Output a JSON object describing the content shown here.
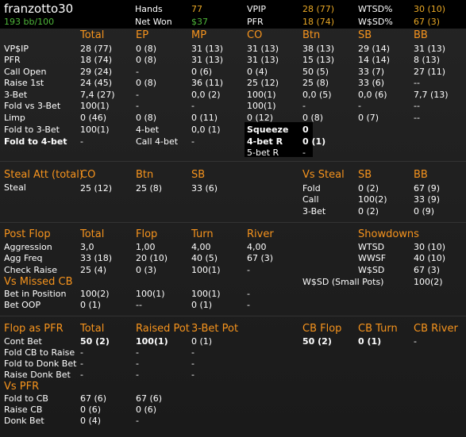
{
  "player": {
    "name": "franzotto30",
    "winrate": "193 bb/100"
  },
  "summary": {
    "hands_label": "Hands",
    "hands_value": "77",
    "netwon_label": "Net Won",
    "netwon_value": "$37",
    "vpip_label": "VPIP",
    "vpip_value": "28 (77)",
    "pfr_label": "PFR",
    "pfr_value": "18 (74)",
    "wtsd_label": "WTSD%",
    "wtsd_value": "30 (10)",
    "wsd_label": "W$SD%",
    "wsd_value": "67 (3)"
  },
  "preflop": {
    "headers": [
      "Total",
      "EP",
      "MP",
      "CO",
      "Btn",
      "SB",
      "BB"
    ],
    "rows": [
      {
        "label": "VP$IP",
        "cells": [
          "28 (77)",
          "0 (8)",
          "31 (13)",
          "31 (13)",
          "38 (13)",
          "29 (14)",
          "31 (13)"
        ]
      },
      {
        "label": "PFR",
        "cells": [
          "18 (74)",
          "0 (8)",
          "31 (13)",
          "31 (13)",
          "15 (13)",
          "14 (14)",
          "8 (13)"
        ]
      },
      {
        "label": "Call Open",
        "cells": [
          "29 (24)",
          "-",
          "0 (6)",
          "0 (4)",
          "50 (5)",
          "33 (7)",
          "27 (11)"
        ]
      },
      {
        "label": "Raise 1st",
        "cells": [
          "24 (45)",
          "0 (8)",
          "36 (11)",
          "25 (12)",
          "25 (8)",
          "33 (6)",
          "--"
        ]
      },
      {
        "label": "3-Bet",
        "cells": [
          "7,4 (27)",
          "-",
          "0,0 (2)",
          "100(1)",
          "0,0 (5)",
          "0,0 (6)",
          "7,7 (13)"
        ]
      },
      {
        "label": "Fold vs 3-Bet",
        "cells": [
          "100(1)",
          "-",
          "-",
          "100(1)",
          "-",
          "-",
          "--"
        ]
      },
      {
        "label": "Limp",
        "cells": [
          "0 (46)",
          "0 (8)",
          "0 (11)",
          "0 (12)",
          "0 (8)",
          "0 (7)",
          "--"
        ]
      }
    ],
    "fold_to_3bet_label": "Fold to 3-Bet",
    "fold_to_3bet_value": "100(1)",
    "fourbet_label": "4-bet",
    "fourbet_value": "0,0 (1)",
    "squeeze_label": "Squeeze",
    "squeeze_value": "0",
    "fold_to_4bet_label": "Fold to 4-bet",
    "fold_to_4bet_value": "-",
    "call_4bet_label": "Call 4-bet",
    "call_4bet_value": "-",
    "fourbet_r_label": "4-bet R",
    "fourbet_r_value": "0 (1)",
    "fivebet_r_label": "5-bet R",
    "fivebet_r_value": "-"
  },
  "steal": {
    "title": "Steal Att (total)",
    "headers": [
      "CO",
      "Btn",
      "SB"
    ],
    "row_label": "Steal",
    "cells": [
      "25 (12)",
      "25 (8)",
      "33 (6)"
    ]
  },
  "vs_steal": {
    "title": "Vs Steal",
    "headers": [
      "SB",
      "BB"
    ],
    "rows": [
      {
        "label": "Fold",
        "cells": [
          "0 (2)",
          "67 (9)"
        ]
      },
      {
        "label": "Call",
        "cells": [
          "100(2)",
          "33 (9)"
        ]
      },
      {
        "label": "3-Bet",
        "cells": [
          "0 (2)",
          "0 (9)"
        ]
      }
    ]
  },
  "postflop": {
    "title": "Post Flop",
    "headers": [
      "Total",
      "Flop",
      "Turn",
      "River"
    ],
    "rows": [
      {
        "label": "Aggression",
        "cells": [
          "3,0",
          "1,00",
          "4,00",
          "4,00"
        ]
      },
      {
        "label": "Agg Freq",
        "cells": [
          "33 (18)",
          "20 (10)",
          "40 (5)",
          "67 (3)"
        ]
      },
      {
        "label": "Check Raise",
        "cells": [
          "25 (4)",
          "0 (3)",
          "100(1)",
          "-"
        ]
      }
    ]
  },
  "showdowns": {
    "title": "Showdowns",
    "rows": [
      {
        "label": "WTSD",
        "value": "30 (10)"
      },
      {
        "label": "WWSF",
        "value": "40 (10)"
      },
      {
        "label": "W$SD",
        "value": "67 (3)"
      }
    ],
    "small_pots_label": "W$SD (Small Pots)",
    "small_pots_value": "100(2)"
  },
  "vs_missed_cb": {
    "title": "Vs Missed CB",
    "rows": [
      {
        "label": "Bet in Position",
        "cells": [
          "100(2)",
          "100(1)",
          "100(1)",
          "-"
        ]
      },
      {
        "label": "Bet OOP",
        "cells": [
          "0 (1)",
          "--",
          "0 (1)",
          "-"
        ]
      }
    ]
  },
  "flop_pfr": {
    "title": "Flop as PFR",
    "headers": [
      "Total",
      "Raised Pot",
      "3-Bet Pot"
    ],
    "rows": [
      {
        "label": "Cont Bet",
        "cells": [
          "50 (2)",
          "100(1)",
          "0 (1)"
        ]
      },
      {
        "label": "Fold CB to Raise",
        "cells": [
          "-",
          "-",
          "-"
        ]
      },
      {
        "label": "Fold to Donk Bet",
        "cells": [
          "-",
          "-",
          "-"
        ]
      },
      {
        "label": "Raise Donk Bet",
        "cells": [
          "-",
          "-",
          "-"
        ]
      }
    ]
  },
  "cb_streets": {
    "headers": [
      "CB Flop",
      "CB Turn",
      "CB River"
    ],
    "cells": [
      "50 (2)",
      "0 (1)",
      "-"
    ]
  },
  "vs_pfr": {
    "title": "Vs PFR",
    "rows": [
      {
        "label": "Fold to CB",
        "cells": [
          "67 (6)",
          "67 (6)"
        ]
      },
      {
        "label": "Raise CB",
        "cells": [
          "0 (6)",
          "0 (6)"
        ]
      },
      {
        "label": "Donk Bet",
        "cells": [
          "0 (4)",
          "-"
        ]
      }
    ]
  }
}
